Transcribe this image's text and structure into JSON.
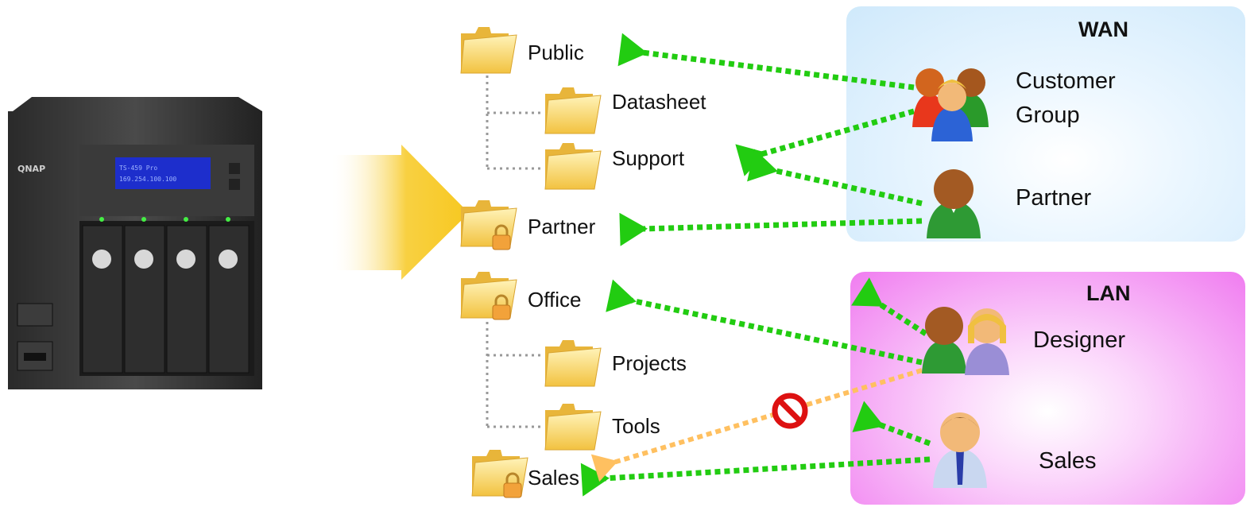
{
  "nas": {
    "brand": "QNAP",
    "lcd_line1": "TS-459 Pro",
    "lcd_line2": "169.254.100.100"
  },
  "folders": {
    "public": "Public",
    "datasheet": "Datasheet",
    "support": "Support",
    "partner": "Partner",
    "office": "Office",
    "projects": "Projects",
    "tools": "Tools",
    "sales": "Sales"
  },
  "zones": {
    "wan": {
      "title": "WAN",
      "color": "#cfe9fb"
    },
    "lan": {
      "title": "LAN",
      "color": "#f07cf0"
    }
  },
  "people": {
    "customer_group": {
      "line1": "Customer",
      "line2": "Group"
    },
    "partner": "Partner",
    "designer": "Designer",
    "sales": "Sales"
  },
  "colors": {
    "allowed_arrow": "#22cc11",
    "denied_arrow": "#ffc060",
    "deny_icon": "#dd1111",
    "folder": "#f5d060",
    "big_arrow": "#f7c820"
  },
  "icons": {
    "nas": "nas-device-icon",
    "folder": "folder-icon",
    "lock": "lock-icon",
    "group": "user-group-icon",
    "person": "user-icon",
    "deny": "no-entry-icon"
  }
}
